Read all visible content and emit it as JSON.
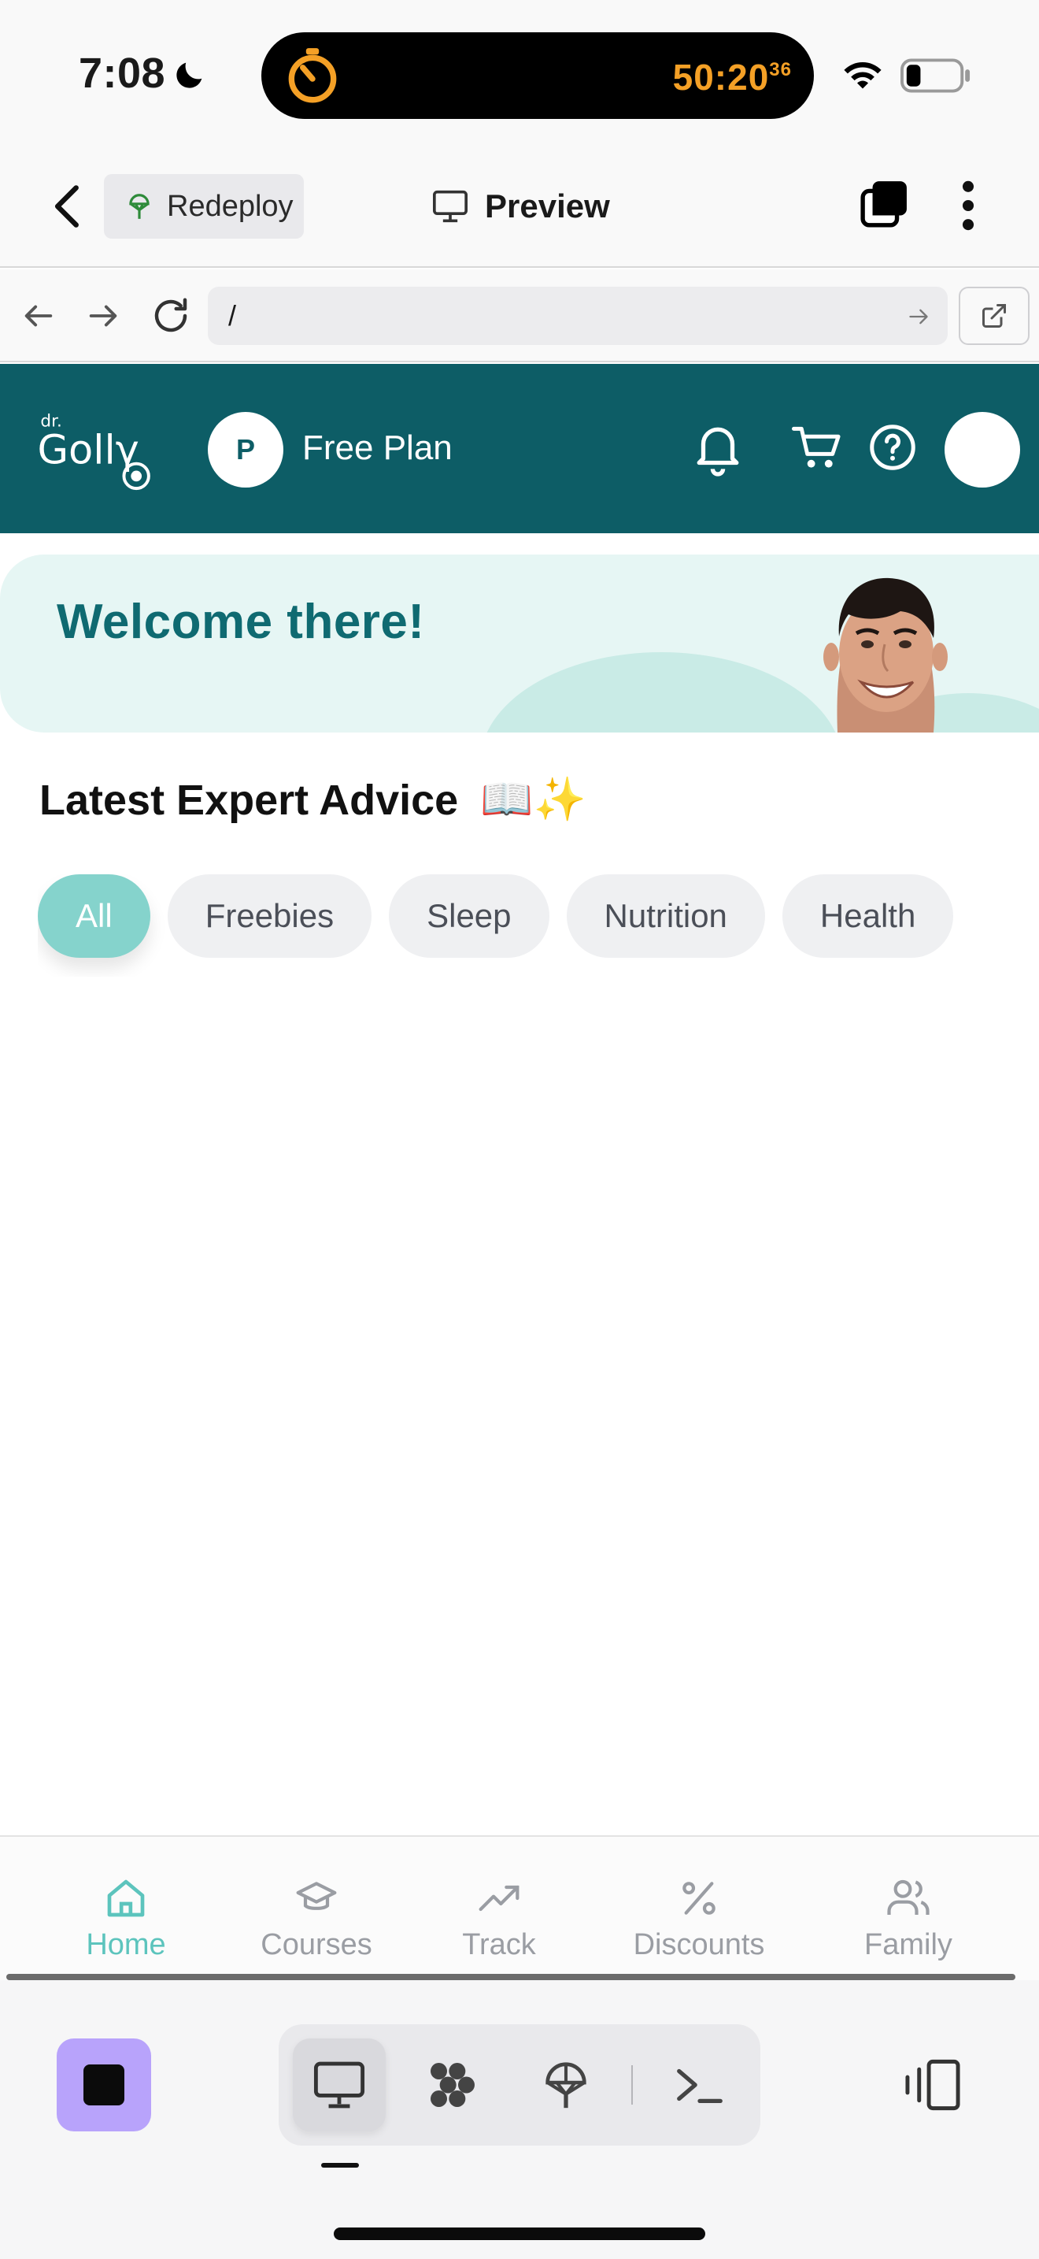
{
  "status_bar": {
    "time": "7:08",
    "timer_main": "50:20",
    "timer_seconds": "36"
  },
  "app_header": {
    "redeploy_label": "Redeploy",
    "preview_label": "Preview"
  },
  "url_bar": {
    "path": "/"
  },
  "golly_header": {
    "plan_initial": "P",
    "plan_label": "Free Plan"
  },
  "welcome": {
    "title": "Welcome there!"
  },
  "advice": {
    "heading": "Latest Expert Advice",
    "heading_emoji": "📖✨",
    "chips": [
      "All",
      "Freebies",
      "Sleep",
      "Nutrition",
      "Health"
    ],
    "active_chip": "All"
  },
  "tab_bar": {
    "items": [
      {
        "label": "Home",
        "icon": "home-icon",
        "active": true
      },
      {
        "label": "Courses",
        "icon": "graduation-cap-icon",
        "active": false
      },
      {
        "label": "Track",
        "icon": "trending-up-icon",
        "active": false
      },
      {
        "label": "Discounts",
        "icon": "percent-icon",
        "active": false
      },
      {
        "label": "Family",
        "icon": "users-icon",
        "active": false
      }
    ]
  },
  "colors": {
    "brand_teal": "#0d5d66",
    "accent_mint": "#85d3cc",
    "active_tab": "#5cc4bd",
    "timer_orange": "#f4a026",
    "stop_purple": "#b8a3fb"
  }
}
